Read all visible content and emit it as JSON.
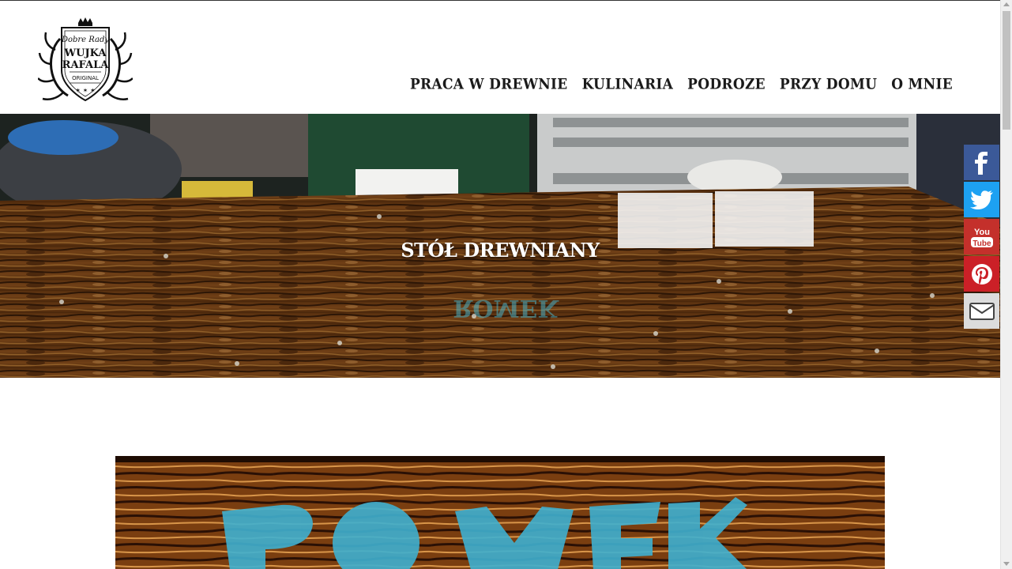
{
  "logo": {
    "script": "Dobre Rady",
    "line1": "WUJKA",
    "line2": "RAFALA",
    "tag": "ORIGINAL"
  },
  "nav": {
    "items": [
      {
        "label": "PRACA W DREWNIE"
      },
      {
        "label": "KULINARIA"
      },
      {
        "label": "PODROZE"
      },
      {
        "label": "PRZY DOMU"
      },
      {
        "label": "O MNIE"
      }
    ]
  },
  "hero": {
    "title": "STÓŁ DREWNIANY"
  },
  "social": {
    "facebook_icon": "facebook-icon",
    "twitter_icon": "twitter-icon",
    "youtube_icon": "youtube-icon",
    "youtube_top": "You",
    "youtube_bottom": "Tube",
    "pinterest_icon": "pinterest-icon",
    "email_icon": "envelope-icon"
  },
  "colors": {
    "facebook": "#3b5998",
    "twitter": "#1da1f2",
    "youtube": "#c4302b",
    "pinterest": "#cb2027",
    "email": "#dcdcdc"
  }
}
